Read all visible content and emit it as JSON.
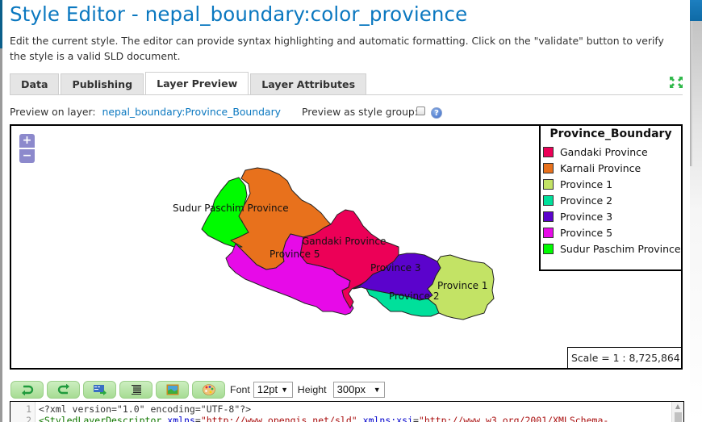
{
  "header": {
    "title": "Style Editor - nepal_boundary:color_provience",
    "description": "Edit the current style. The editor can provide syntax highlighting and automatic formatting. Click on the \"validate\" button to verify the style is a valid SLD document."
  },
  "tabs": [
    {
      "label": "Data",
      "active": false
    },
    {
      "label": "Publishing",
      "active": false
    },
    {
      "label": "Layer Preview",
      "active": true
    },
    {
      "label": "Layer Attributes",
      "active": false
    }
  ],
  "preview": {
    "layer_label": "Preview on layer:",
    "layer_name": "nepal_boundary:Province_Boundary",
    "style_group_label": "Preview as style group:",
    "style_group_checked": false
  },
  "map": {
    "zoom_in": "+",
    "zoom_out": "−",
    "labels": {
      "sudur": "Sudur Paschim Province",
      "gandaki": "Gandaki Province",
      "p5": "Province 5",
      "p3": "Province 3",
      "p2": "Province 2",
      "p1": "Province 1"
    },
    "legend": {
      "title": "Province_Boundary",
      "items": [
        {
          "label": "Gandaki Province",
          "color": "#ec0057"
        },
        {
          "label": "Karnali Province",
          "color": "#e8711c"
        },
        {
          "label": "Province 1",
          "color": "#c3e365"
        },
        {
          "label": "Province 2",
          "color": "#00e09b"
        },
        {
          "label": "Province 3",
          "color": "#5b03cc"
        },
        {
          "label": "Province 5",
          "color": "#e70ae8"
        },
        {
          "label": "Sudur Paschim Province",
          "color": "#00fb00"
        }
      ]
    },
    "scale": "Scale = 1 : 8,725,864"
  },
  "toolbar": {
    "buttons": [
      "undo",
      "redo",
      "go-to-line",
      "reformat",
      "insert-image",
      "color-picker"
    ],
    "font_label": "Font",
    "font_value": "12pt",
    "height_label": "Height",
    "height_value": "300px"
  },
  "editor": {
    "lines": [
      {
        "num": "1",
        "text": "<?xml version=\"1.0\" encoding=\"UTF-8\"?>"
      },
      {
        "num": "2",
        "tag": "<StyledLayerDescriptor",
        "a1": "xmlns",
        "v1": "\"http://www.opengis.net/sld\"",
        "a2": "xmlns:xsi",
        "v2": "\"http://www.w3.org/2001/XMLSchema-"
      }
    ]
  }
}
